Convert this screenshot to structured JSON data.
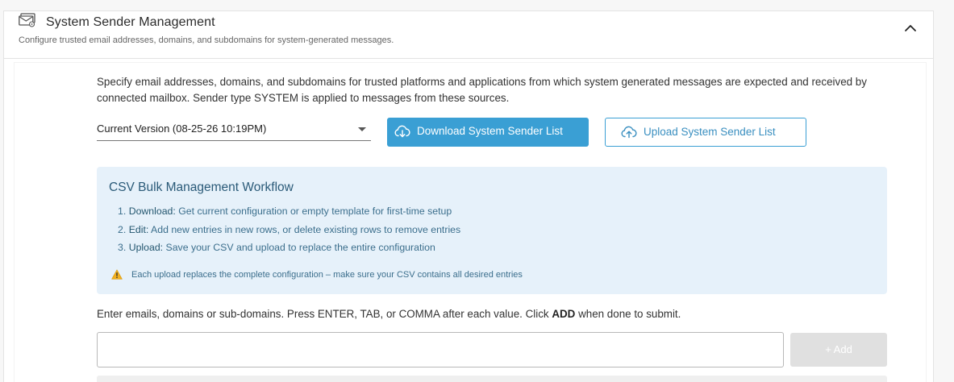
{
  "section": {
    "title": "System Sender Management",
    "subtitle": "Configure trusted email addresses, domains, and subdomains for system-generated messages.",
    "header_icon": "mail-settings-icon",
    "collapse_icon": "chevron-up-icon"
  },
  "description": "Specify email addresses, domains, and subdomains for trusted platforms and applications from which system generated messages are expected and received by connected mailbox. Sender type SYSTEM is applied to messages from these sources.",
  "version_select": {
    "value": "Current Version (08-25-26 10:19PM)"
  },
  "buttons": {
    "download_label": "Download System Sender List",
    "upload_label": "Upload System Sender List",
    "add_label": "+ Add"
  },
  "workflow": {
    "title": "CSV Bulk Management Workflow",
    "steps": [
      {
        "num": "1.",
        "key": "Download:",
        "text": "Get current configuration or empty template for first-time setup"
      },
      {
        "num": "2.",
        "key": "Edit:",
        "text": "Add new entries in new rows, or delete existing rows to remove entries"
      },
      {
        "num": "3.",
        "key": "Upload:",
        "text": "Save your CSV and upload to replace the entire configuration"
      }
    ],
    "warning": "Each upload replaces the complete configuration – make sure your CSV contains all desired entries"
  },
  "instructions": {
    "before": "Enter emails, domains or sub-domains. Press ENTER, TAB, or COMMA after each value. Click ",
    "add_word": "ADD",
    "after": " when done to submit."
  },
  "entry_input": {
    "value": "",
    "placeholder": ""
  },
  "colors": {
    "primary": "#3a9fd4",
    "info_bg": "#e6f1fa",
    "info_text": "#3b6e8c",
    "disabled": "#e0e0e0",
    "warning": "#f2b01e"
  }
}
